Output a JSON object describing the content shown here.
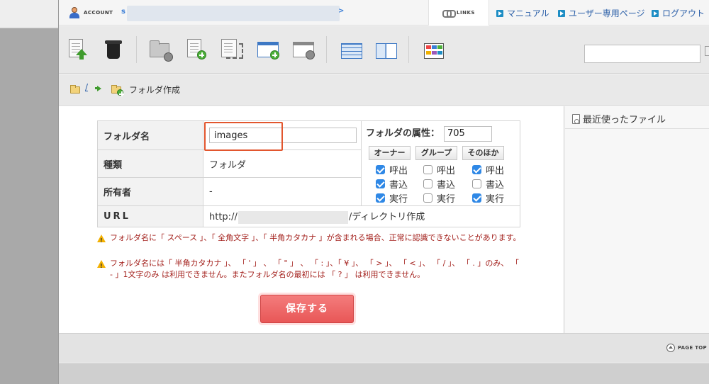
{
  "topbar": {
    "account_label": "ACCOUNT",
    "account_prefix": "s",
    "account_suffix": ">",
    "links_label": "LINKS",
    "menu": [
      {
        "label": "マニュアル"
      },
      {
        "label": "ユーザー専用ページ"
      },
      {
        "label": "ログアウト"
      }
    ]
  },
  "breadcrumb": {
    "root": "/",
    "current": "フォルダ作成"
  },
  "form": {
    "folder_name_label": "フォルダ名",
    "folder_name_value": "images",
    "type_label": "種類",
    "type_value": "フォルダ",
    "owner_label": "所有者",
    "owner_value": "-",
    "url_label": "URL",
    "url_prefix": "http://",
    "url_suffix": "/ディレクトリ作成",
    "attr_label": "フォルダの属性：",
    "attr_value": "705",
    "perm_headers": [
      "オーナー",
      "グループ",
      "そのほか"
    ],
    "perm_rows": [
      "呼出",
      "書込",
      "実行"
    ],
    "permissions": {
      "owner": [
        true,
        true,
        true
      ],
      "group": [
        false,
        false,
        false
      ],
      "other": [
        true,
        false,
        true
      ]
    }
  },
  "notes": [
    "フォルダ名に「 スペース 」、「 全角文字 」、「 半角カタカナ 」が含まれる場合、正常に認識できないことがあります。",
    "フォルダ名には「 半角カタカナ 」、 「 ' 」 、 「 \" 」 、 「 : 」、「 ¥ 」、 「 > 」、 「 < 」、 「 / 」、 「 . 」のみ、 「 - 」1文字のみ は利用できません。またフォルダ名の最初には 「 ? 」 は利用できません。"
  ],
  "save_label": "保存する",
  "sidebar": {
    "recent_label": "最近使ったファイル"
  },
  "footer": {
    "pagetop_label": "PAGE TOP"
  }
}
